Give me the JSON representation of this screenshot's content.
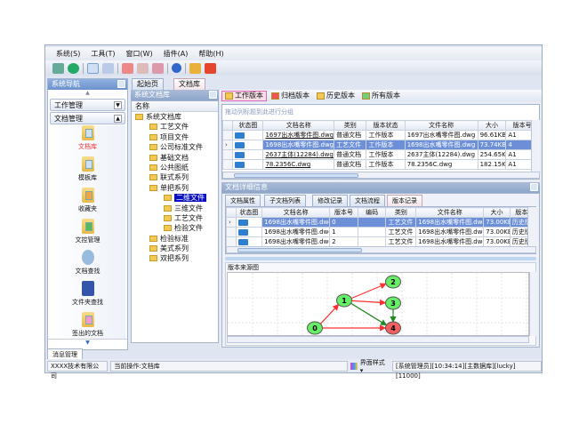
{
  "menu": [
    "系统(S)",
    "工具(T)",
    "窗口(W)",
    "插件(A)",
    "帮助(H)"
  ],
  "toolbar_icons": [
    "connect-icon",
    "globe-icon",
    "window-icon",
    "layout-icon",
    "doc-red-icon",
    "doc-check-icon",
    "doc-x-icon",
    "help-icon",
    "lock-icon",
    "power-icon"
  ],
  "nav": {
    "title": "系统导航",
    "groups": [
      "工作管理",
      "文档管理"
    ],
    "items": [
      {
        "label": "文档库",
        "active": true
      },
      {
        "label": "模板库"
      },
      {
        "label": "收藏夹"
      },
      {
        "label": "文控管理"
      },
      {
        "label": "文档查找"
      },
      {
        "label": "文件夹查找"
      },
      {
        "label": "签出的文档"
      }
    ]
  },
  "tabs": [
    "起始页",
    "文档库"
  ],
  "tree": {
    "title": "系统文档库",
    "column": "名称",
    "items": [
      {
        "label": "系统文档库",
        "level": 0
      },
      {
        "label": "工艺文件",
        "level": 1
      },
      {
        "label": "项目文件",
        "level": 1
      },
      {
        "label": "公司标准文件",
        "level": 1
      },
      {
        "label": "基础文档",
        "level": 1
      },
      {
        "label": "公共图纸",
        "level": 1
      },
      {
        "label": "联式系列",
        "level": 1
      },
      {
        "label": "单把系列",
        "level": 1
      },
      {
        "label": "二维文件",
        "level": 2,
        "selected": true
      },
      {
        "label": "三维文件",
        "level": 2
      },
      {
        "label": "工艺文件",
        "level": 2
      },
      {
        "label": "检验文件",
        "level": 2
      },
      {
        "label": "检验标准",
        "level": 1
      },
      {
        "label": "美式系列",
        "level": 1
      },
      {
        "label": "双把系列",
        "level": 1
      }
    ]
  },
  "version_buttons": [
    "工作版本",
    "归档版本",
    "历史版本",
    "所有版本"
  ],
  "group_hint": "拖动列标题到此进行分组",
  "doc_grid": {
    "columns": [
      "状态图",
      "文档名称",
      "类别",
      "版本状态",
      "文件名称",
      "大小",
      "版本号",
      "签出状态"
    ],
    "rows": [
      [
        "",
        "1697出水嘴零件图.dwg",
        "普通文档",
        "工作版本",
        "1697出水嘴零件图.dwg",
        "96.61KB",
        "A1",
        "未签出"
      ],
      [
        "",
        "1698出水嘴零件图.dwg",
        "工艺文件",
        "工作版本",
        "1698出水嘴零件图.dwg",
        "73.74KB",
        "4",
        "未签出"
      ],
      [
        "",
        "2637主体(12284).dwg",
        "普通文档",
        "工作版本",
        "2637主体(12284).dwg",
        "254.65KB",
        "A1",
        "未签出"
      ],
      [
        "",
        "78.2356C.dwg",
        "普通文档",
        "工作版本",
        "78.2356C.dwg",
        "182.15KB",
        "A1",
        "未签出"
      ]
    ],
    "selected_row": 1
  },
  "detail": {
    "title": "文档详细信息",
    "tabs": [
      "文档属性",
      "子文档列表",
      "修改记录",
      "文档流程",
      "版本记录"
    ],
    "active_tab": 4,
    "columns": [
      "状态图",
      "文档名称",
      "版本号",
      "编码",
      "类别",
      "文件名称",
      "大小",
      "版本状态"
    ],
    "rows": [
      [
        "",
        "1698出水嘴零件图.dwg",
        "0",
        "",
        "工艺文件",
        "1698出水嘴零件图.dwg",
        "73.00KB",
        "历史版本"
      ],
      [
        "",
        "1698出水嘴零件图.dwg",
        "1",
        "",
        "工艺文件",
        "1698出水嘴零件图.dwg",
        "73.00KB",
        "历史版本"
      ],
      [
        "",
        "1698出水嘴零件图.dwg",
        "2",
        "",
        "工艺文件",
        "1698出水嘴零件图.dwg",
        "73.00KB",
        "历史版本"
      ]
    ]
  },
  "graph": {
    "title": "版本来源图",
    "nodes": [
      {
        "id": "0",
        "color": "#66ee66"
      },
      {
        "id": "1",
        "color": "#66ee66"
      },
      {
        "id": "2",
        "color": "#66ee66"
      },
      {
        "id": "3",
        "color": "#66ee66"
      },
      {
        "id": "4",
        "color": "#f06060"
      }
    ],
    "edges": [
      {
        "from": "0",
        "to": "1",
        "color": "#ff3030"
      },
      {
        "from": "0",
        "to": "4",
        "color": "#ff3030"
      },
      {
        "from": "1",
        "to": "2",
        "color": "#ff3030"
      },
      {
        "from": "1",
        "to": "3",
        "color": "#ff3030"
      },
      {
        "from": "1",
        "to": "4",
        "color": "#228822"
      },
      {
        "from": "3",
        "to": "4",
        "color": "#228822"
      }
    ]
  },
  "bottom_tab": "消息管理",
  "status": {
    "company": "XXXX技术有限公司",
    "operation": "当前操作:文档库",
    "style": "界面样式",
    "info": "[系统管理员][10:34:14][主数据库][lucky][11000]"
  }
}
